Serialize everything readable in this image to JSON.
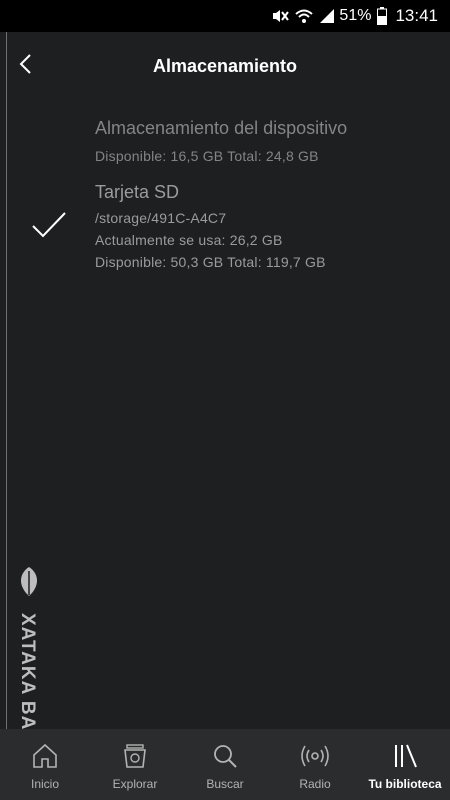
{
  "status_bar": {
    "battery_percent": "51%",
    "time": "13:41",
    "icons": [
      "mute-icon",
      "wifi-icon",
      "signal-icon",
      "battery-icon"
    ]
  },
  "header": {
    "title": "Almacenamiento",
    "back_icon": "chevron-left-icon"
  },
  "storage_options": [
    {
      "title": "Almacenamiento del dispositivo",
      "details": [
        "Disponible: 16,5 GB Total: 24,8 GB"
      ],
      "selected": false
    },
    {
      "title": "Tarjeta SD",
      "details": [
        "/storage/491C-A4C7",
        "Actualmente se usa: 26,2 GB",
        "Disponible: 50,3 GB Total: 119,7 GB"
      ],
      "selected": true
    }
  ],
  "watermark": {
    "text": "XATAKA BASICS"
  },
  "bottom_nav": {
    "items": [
      {
        "label": "Inicio",
        "icon": "home-icon",
        "active": false
      },
      {
        "label": "Explorar",
        "icon": "explore-icon",
        "active": false
      },
      {
        "label": "Buscar",
        "icon": "search-icon",
        "active": false
      },
      {
        "label": "Radio",
        "icon": "radio-icon",
        "active": false
      },
      {
        "label": "Tu biblioteca",
        "icon": "library-icon",
        "active": true
      }
    ]
  },
  "colors": {
    "background": "#1e1f21",
    "status_bar": "#000000",
    "nav_bar": "#2b2c2e",
    "muted_text": "#838486",
    "active_text": "#ffffff"
  }
}
